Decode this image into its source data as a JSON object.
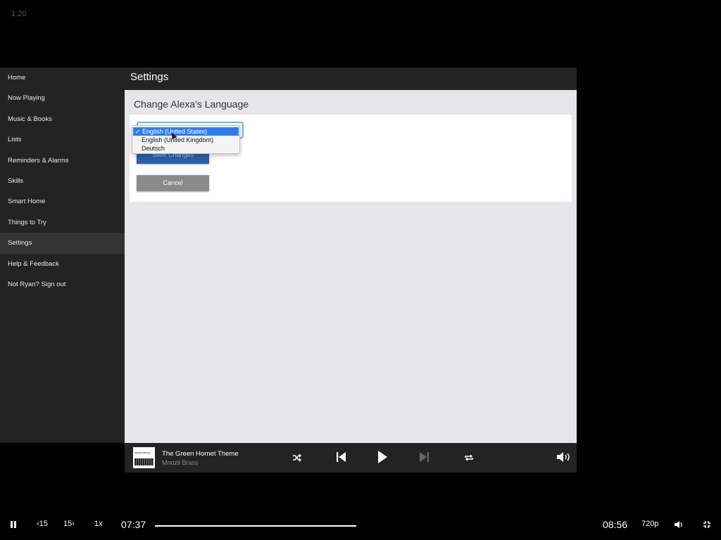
{
  "version": "1.20",
  "sidebar": {
    "items": [
      {
        "label": "Home"
      },
      {
        "label": "Now Playing"
      },
      {
        "label": "Music & Books"
      },
      {
        "label": "Lists"
      },
      {
        "label": "Reminders & Alarms"
      },
      {
        "label": "Skills"
      },
      {
        "label": "Smart Home"
      },
      {
        "label": "Things to Try"
      },
      {
        "label": "Settings",
        "active": true
      },
      {
        "label": "Help & Feedback"
      },
      {
        "label": "Not Ryan? Sign out"
      }
    ]
  },
  "main": {
    "header_title": "Settings",
    "section_title": "Change Alexa's Language",
    "language_select": {
      "selected": "English (United States)",
      "options": [
        "English (United States)",
        "English (United Kingdom)",
        "Deutsch"
      ],
      "check": "✓"
    },
    "save_label": "Save Changes",
    "cancel_label": "Cancel"
  },
  "player": {
    "album_art_text": "MNOZIL BRASS",
    "track_title": "The Green Hornet Theme",
    "track_artist": "Mnozil Brass",
    "icons": [
      "shuffle-icon",
      "previous-track-icon",
      "play-icon",
      "next-track-icon",
      "repeat-icon",
      "volume-icon"
    ]
  },
  "video_controls": {
    "rewind_label": "15",
    "forward_label": "15",
    "speed_label": "1x",
    "current_time": "07:37",
    "total_time": "08:56",
    "quality_label": "720p",
    "progress": 0.852
  },
  "colors": {
    "sidebar_bg": "#232323",
    "accent_blue": "#2a5ea6",
    "selected_option": "#2d7cf6",
    "content_bg": "#e6e5e9"
  }
}
